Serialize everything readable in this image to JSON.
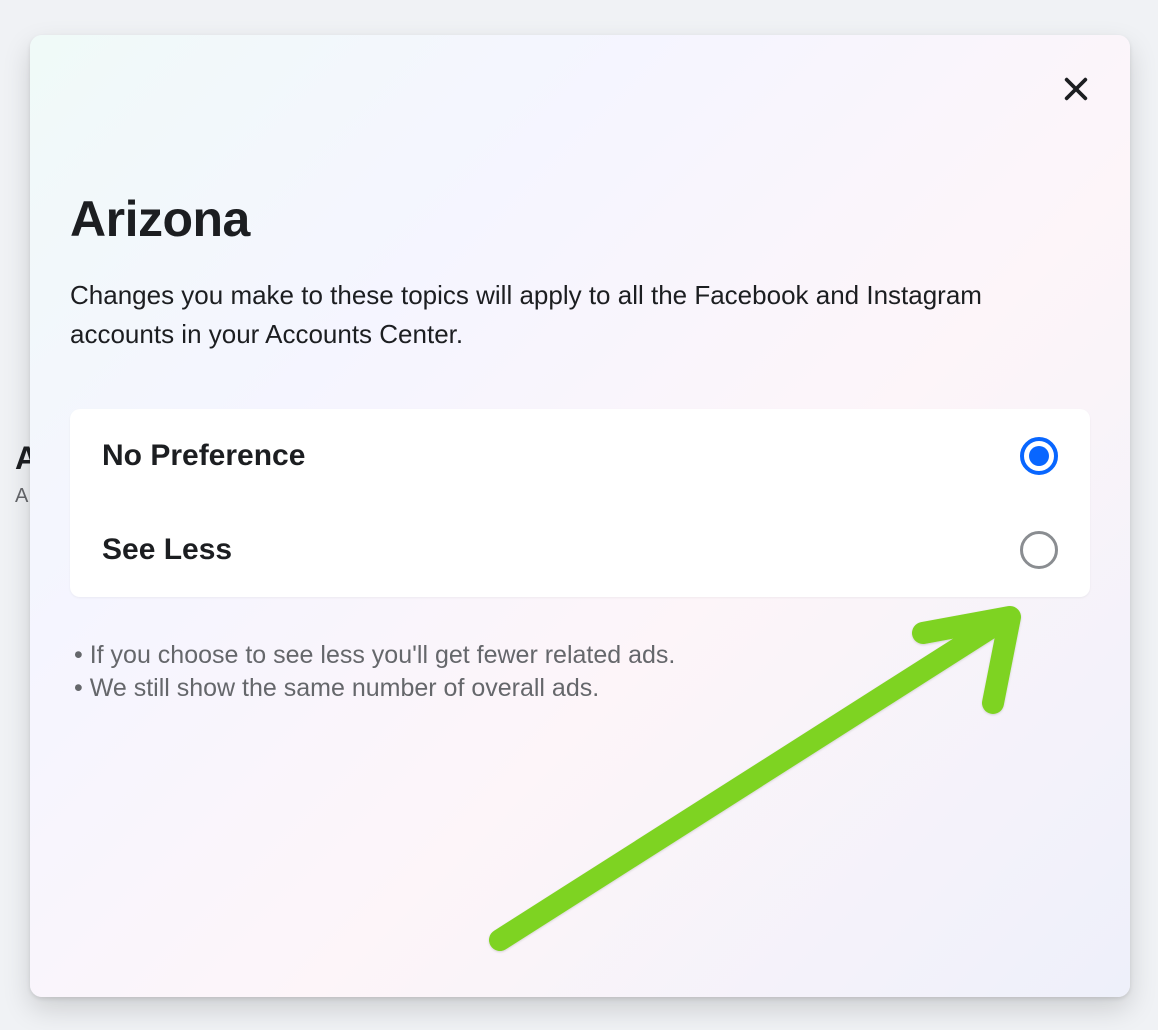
{
  "background": {
    "heading": "A",
    "subtext": "A"
  },
  "modal": {
    "title": "Arizona",
    "description": "Changes you make to these topics will apply to all the Facebook and Instagram accounts in your Accounts Center.",
    "options": [
      {
        "label": "No Preference",
        "selected": true
      },
      {
        "label": "See Less",
        "selected": false
      }
    ],
    "info": [
      "• If you choose to see less you'll get fewer related ads.",
      "• We still show the same number of overall ads."
    ]
  }
}
